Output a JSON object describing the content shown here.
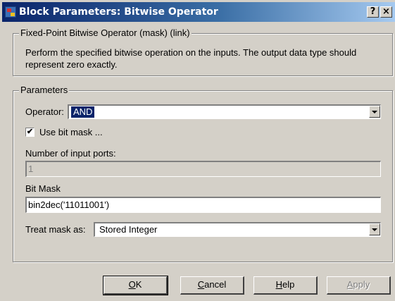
{
  "window": {
    "title": "Block Parameters: Bitwise Operator"
  },
  "titlebar_buttons": {
    "help": "?",
    "close": "×"
  },
  "mask_group": {
    "legend": "Fixed-Point Bitwise Operator (mask) (link)",
    "description": "Perform the specified bitwise operation on the inputs. The output data type should represent zero exactly."
  },
  "parameters": {
    "legend": "Parameters",
    "operator_label": "Operator:",
    "operator_value": "AND",
    "use_bit_mask_label": "Use bit mask ...",
    "use_bit_mask_checked": true,
    "num_ports_label": "Number of input ports:",
    "num_ports_value": "1",
    "bit_mask_label": "Bit Mask",
    "bit_mask_value": "bin2dec('11011001')",
    "treat_mask_label": "Treat mask as:",
    "treat_mask_value": "Stored Integer"
  },
  "buttons": {
    "ok": {
      "mnemonic": "O",
      "rest": "K"
    },
    "cancel": {
      "mnemonic": "C",
      "rest": "ancel"
    },
    "help": {
      "mnemonic": "H",
      "rest": "elp"
    },
    "apply": {
      "mnemonic": "A",
      "rest": "pply"
    }
  },
  "icons": {
    "app": "simulink-block-icon",
    "dropdown": "chevron-down-icon",
    "check": "checkmark-icon"
  }
}
